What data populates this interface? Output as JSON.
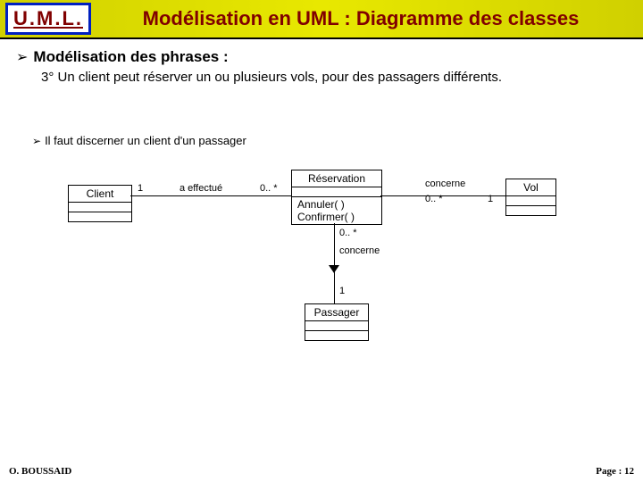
{
  "header": {
    "logo": "U.M.L.",
    "title": "Modélisation en UML : Diagramme des classes"
  },
  "bullet": {
    "title": "Modélisation des phrases :",
    "subtitle": "3° Un client peut réserver un ou plusieurs vols, pour des passagers différents."
  },
  "note": {
    "text": "Il faut discerner un client d'un passager"
  },
  "uml": {
    "client": "Client",
    "reservation": "Réservation",
    "vol": "Vol",
    "passager": "Passager",
    "ops": {
      "annuler": "Annuler( )",
      "confirmer": "Confirmer( )"
    },
    "assoc": {
      "aeffectue": "a effectué",
      "concerne1": "concerne",
      "concerne2": "concerne"
    },
    "mult": {
      "one_a": "1",
      "zerostar_a": "0.. *",
      "zerostar_b": "0.. *",
      "one_b": "1",
      "zerostar_c": "0.. *",
      "one_c": "1"
    }
  },
  "footer": {
    "author": "O. BOUSSAID",
    "page": "Page : 12"
  }
}
